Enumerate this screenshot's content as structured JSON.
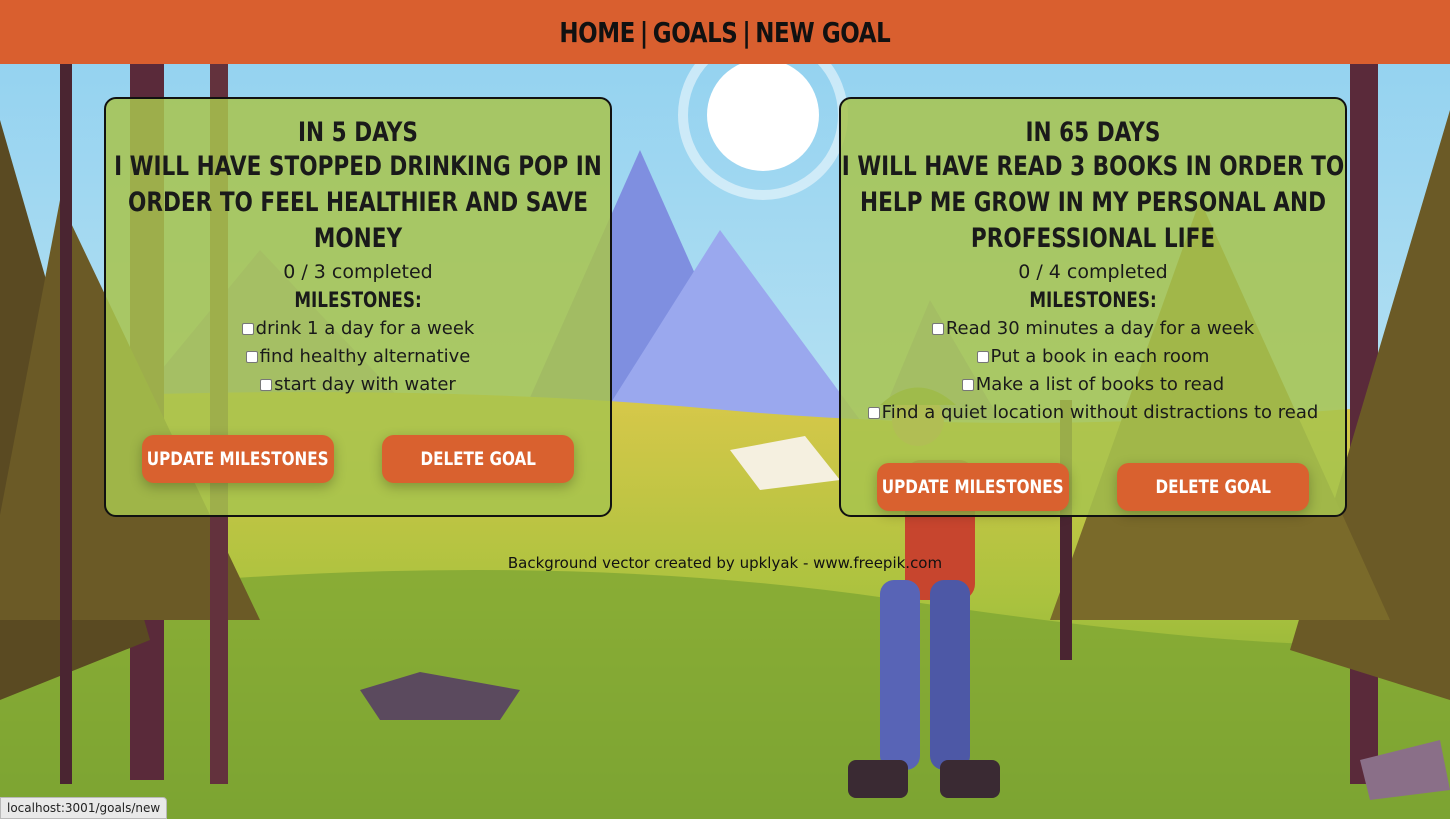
{
  "nav": {
    "home": "HOME",
    "goals": "GOALS",
    "new_goal": "NEW GOAL",
    "separator": "|"
  },
  "goals": [
    {
      "days_label": "IN 5 DAYS",
      "statement": "I WILL HAVE STOPPED DRINKING POP IN ORDER TO FEEL HEALTHIER AND SAVE MONEY",
      "progress": "0 / 3 completed",
      "milestones_title": "MILESTONES:",
      "milestones": [
        {
          "label": "drink 1 a day for a week",
          "checked": false
        },
        {
          "label": "find healthy alternative",
          "checked": false
        },
        {
          "label": "start day with water",
          "checked": false
        }
      ],
      "update_label": "UPDATE MILESTONES",
      "delete_label": "DELETE GOAL"
    },
    {
      "days_label": "IN 65 DAYS",
      "statement": "I WILL HAVE READ 3 BOOKS IN ORDER TO HELP ME GROW IN MY PERSONAL AND PROFESSIONAL LIFE",
      "progress": "0 / 4 completed",
      "milestones_title": "MILESTONES:",
      "milestones": [
        {
          "label": "Read 30 minutes a day for a week",
          "checked": false
        },
        {
          "label": "Put a book in each room",
          "checked": false
        },
        {
          "label": "Make a list of books to read",
          "checked": false
        },
        {
          "label": "Find a quiet location without distractions to read",
          "checked": false
        }
      ],
      "update_label": "UPDATE MILESTONES",
      "delete_label": "DELETE GOAL"
    }
  ],
  "credit": "Background vector created by upklyak - www.freepik.com",
  "status_bar": "localhost:3001/goals/new",
  "colors": {
    "nav_bg": "#d95f2f",
    "card_bg": "#a8c44e",
    "button_bg": "#d9612f"
  }
}
